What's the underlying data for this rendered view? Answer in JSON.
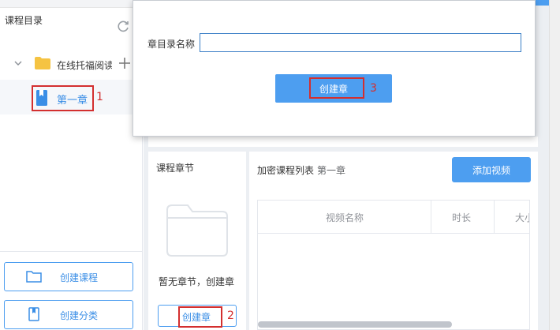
{
  "sidebar": {
    "title": "课程目录",
    "course_name": "在线托福阅读",
    "chapter_name": "第一章",
    "annotation_1": "1",
    "buttons": [
      {
        "label": "创建课程"
      },
      {
        "label": "创建分类"
      }
    ]
  },
  "chapters_panel": {
    "title": "课程章节",
    "empty_text": "暂无章节，创建章",
    "create_label": "创建章",
    "annotation_2": "2"
  },
  "video_list": {
    "title": "加密课程列表",
    "current_chapter": "第一章",
    "add_button": "添加视频",
    "columns": [
      "视频名称",
      "时长",
      "大小"
    ]
  },
  "dialog": {
    "field_label": "章目录名称",
    "field_value": "",
    "submit_label": "创建章",
    "annotation_3": "3"
  },
  "colors": {
    "accent": "#4d9ef0",
    "annotation": "#d32f2f",
    "link": "#3a8ee6"
  }
}
